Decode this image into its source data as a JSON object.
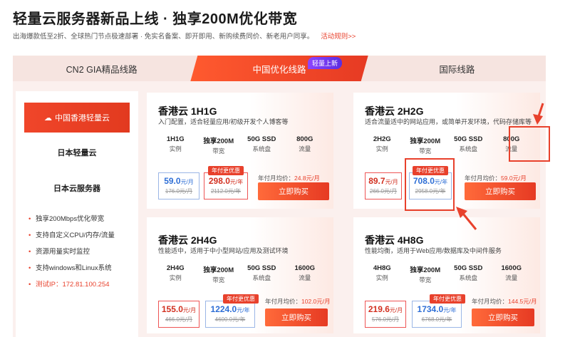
{
  "header": {
    "title": "轻量云服务器新品上线 · 独享200M优化带宽",
    "subtitle": "出海爆款低至2折、全球热门节点极速部署 · 免实名备案、即开即用、新购续费同价、新老用户同享。",
    "rules_link": "活动规则>>"
  },
  "tabs": [
    {
      "label": "CN2 GIA精品线路"
    },
    {
      "label": "中国优化线路",
      "badge": "轻量上新"
    },
    {
      "label": "国际线路"
    }
  ],
  "sidebar": {
    "active": "中国香港轻量云",
    "item1": "日本轻量云",
    "item2": "日本云服务器",
    "features": [
      "独享200Mbps优化带宽",
      "支持自定义CPU/内存/流量",
      "资源用量实时监控",
      "支持windows和Linux系统",
      "测试IP：172.81.100.254"
    ]
  },
  "cards": [
    {
      "title": "香港云 1H1G",
      "desc": "入门配置，适合轻量应用/初级开发个人博客等",
      "specs": [
        {
          "v": "1H1G",
          "l": "实例"
        },
        {
          "v": "独享200M",
          "l": "带宽"
        },
        {
          "v": "50G SSD",
          "l": "系统盘"
        },
        {
          "v": "800G",
          "l": "流量"
        }
      ],
      "monthly": {
        "price": "59.0",
        "unit": "元/月",
        "orig": "176.0元/月"
      },
      "yearly": {
        "price": "298.0",
        "unit": "元/年",
        "orig": "2112.0元/年",
        "ribbon": "年付更优惠"
      },
      "avg_label": "年付月均价：",
      "avg_value": "24.8元/月",
      "buy": "立即购买"
    },
    {
      "title": "香港云 2H2G",
      "desc": "适合流量适中的网站应用，或简单开发环境，代码存储库等",
      "specs": [
        {
          "v": "2H2G",
          "l": "实例"
        },
        {
          "v": "独享200M",
          "l": "带宽"
        },
        {
          "v": "50G SSD",
          "l": "系统盘"
        },
        {
          "v": "800G",
          "l": "流量"
        }
      ],
      "monthly": {
        "price": "89.7",
        "unit": "元/月",
        "orig": "266.0元/月"
      },
      "yearly": {
        "price": "708.0",
        "unit": "元/年",
        "orig": "2958.0元/年",
        "ribbon": "年付更优惠"
      },
      "avg_label": "年付月均价：",
      "avg_value": "59.0元/月",
      "buy": "立即购买"
    },
    {
      "title": "香港云 2H4G",
      "desc": "性能适中，适用于中小型网站/应用及测试环境",
      "specs": [
        {
          "v": "2H4G",
          "l": "实例"
        },
        {
          "v": "独享200M",
          "l": "带宽"
        },
        {
          "v": "50G SSD",
          "l": "系统盘"
        },
        {
          "v": "1600G",
          "l": "流量"
        }
      ],
      "monthly": {
        "price": "155.0",
        "unit": "元/月",
        "orig": "466.0元/月"
      },
      "yearly": {
        "price": "1224.0",
        "unit": "元/年",
        "orig": "4600.0元/年",
        "ribbon": "年付更优惠"
      },
      "avg_label": "年付月均价：",
      "avg_value": "102.0元/月",
      "buy": "立即购买"
    },
    {
      "title": "香港云 4H8G",
      "desc": "性能均衡，适用于Web应用/数据库及中间件服务",
      "specs": [
        {
          "v": "4H8G",
          "l": "实例"
        },
        {
          "v": "独享200M",
          "l": "带宽"
        },
        {
          "v": "50G SSD",
          "l": "系统盘"
        },
        {
          "v": "1600G",
          "l": "流量"
        }
      ],
      "monthly": {
        "price": "219.6",
        "unit": "元/月",
        "orig": "576.0元/月"
      },
      "yearly": {
        "price": "1734.0",
        "unit": "元/年",
        "orig": "6768.0元/年",
        "ribbon": "年付更优惠"
      },
      "avg_label": "年付月均价：",
      "avg_value": "144.5元/月",
      "buy": "立即购买"
    }
  ],
  "colors": {
    "accent": "#e8412c",
    "blue": "#2f6fd6",
    "badge": "#7a3cf0"
  }
}
